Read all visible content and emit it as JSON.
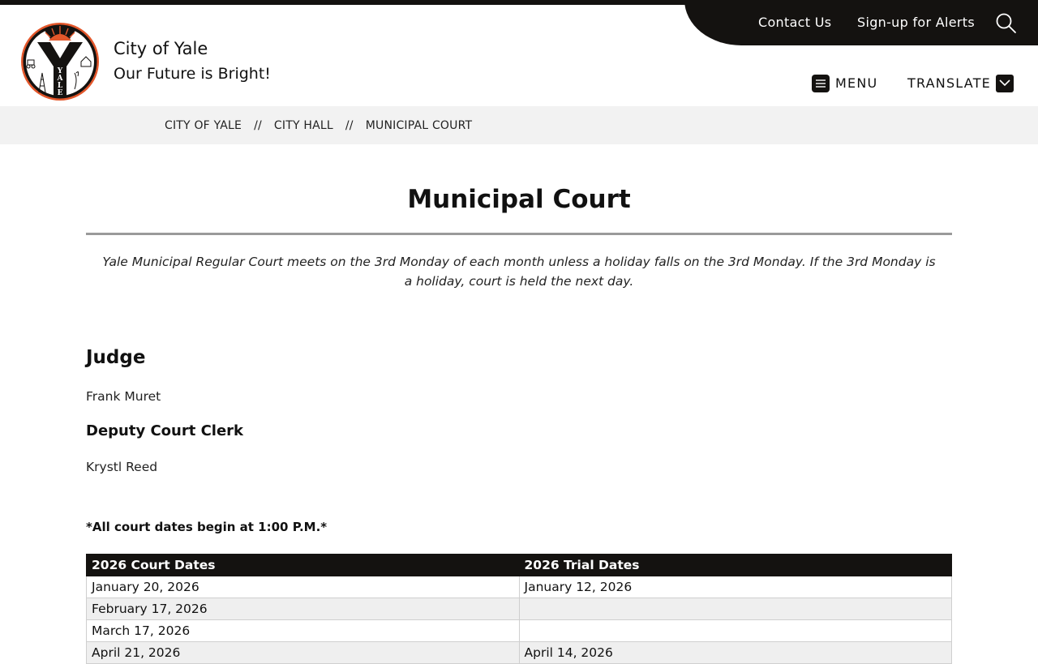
{
  "utility_nav": {
    "contact": "Contact Us",
    "alerts": "Sign-up for Alerts"
  },
  "site": {
    "name": "City of Yale",
    "tagline": "Our Future is Bright!",
    "logo_letters": [
      "Y",
      "A",
      "L",
      "E"
    ]
  },
  "nav": {
    "menu_label": "MENU",
    "translate_label": "TRANSLATE"
  },
  "breadcrumb": {
    "items": [
      "CITY OF YALE",
      "CITY HALL",
      "MUNICIPAL COURT"
    ],
    "separator": "//"
  },
  "page": {
    "title": "Municipal Court",
    "intro": "Yale Municipal Regular Court meets on the 3rd Monday of each month unless a holiday falls on the 3rd Monday.  If the 3rd Monday is a holiday, court is held the next day.",
    "judge_heading": "Judge",
    "judge_name": "Frank Muret",
    "clerk_heading": "Deputy Court Clerk",
    "clerk_name": "Krystl Reed",
    "note": "*All court dates begin at 1:00 P.M.*"
  },
  "table": {
    "headers": [
      "2026 Court Dates",
      "2026 Trial Dates"
    ],
    "rows": [
      [
        "January 20, 2026",
        "January 12, 2026"
      ],
      [
        "February 17, 2026",
        ""
      ],
      [
        "March 17, 2026",
        ""
      ],
      [
        "April 21, 2026",
        "April 14, 2026"
      ]
    ]
  },
  "colors": {
    "dark": "#141210",
    "accent_orange": "#e3572b",
    "breadcrumb_bg": "#f2f2f2"
  },
  "icons": {
    "search": "search-icon",
    "menu": "hamburger-icon",
    "translate": "chevron-down-icon"
  }
}
